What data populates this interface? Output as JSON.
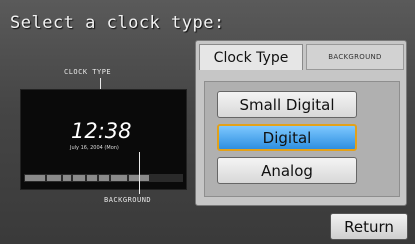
{
  "header": {
    "title": "Select a clock type:"
  },
  "preview": {
    "clock_type_label": "CLOCK TYPE",
    "background_label": "BACKGROUND",
    "time": "12:38",
    "date": "July 16, 2004 (Mon)"
  },
  "tabs": [
    {
      "label": "Clock Type",
      "active": true
    },
    {
      "label": "BACKGROUND",
      "active": false
    }
  ],
  "options": [
    {
      "label": "Small Digital",
      "selected": false
    },
    {
      "label": "Digital",
      "selected": true
    },
    {
      "label": "Analog",
      "selected": false
    }
  ],
  "footer": {
    "return_label": "Return"
  },
  "colors": {
    "selected_fill": "#2e8fe0",
    "selected_border": "#e3a11a"
  }
}
